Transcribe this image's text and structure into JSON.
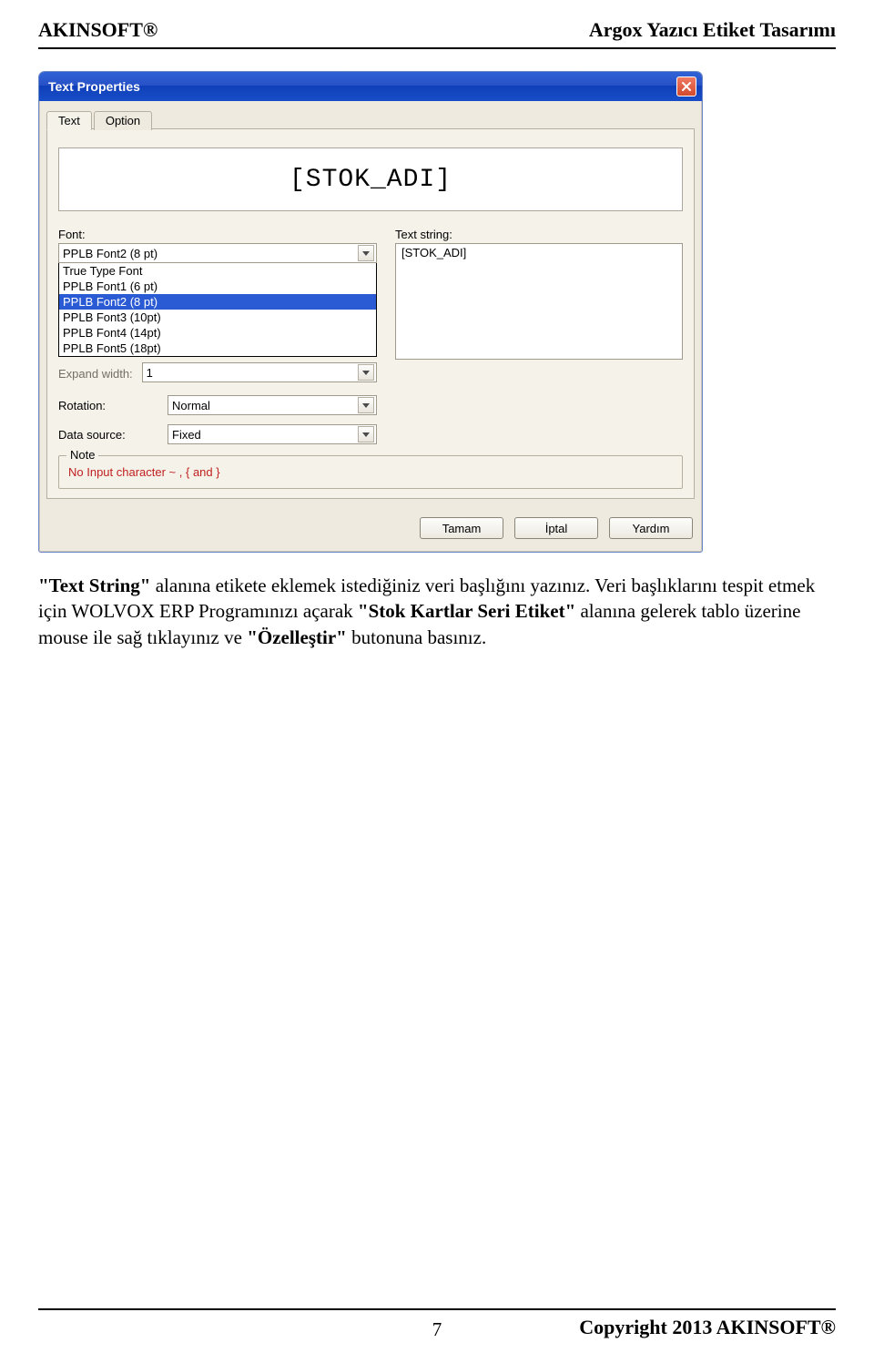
{
  "page": {
    "header_left": "AKINSOFT®",
    "header_right": "Argox Yazıcı Etiket Tasarımı",
    "footer_right": "Copyright 2013 AKINSOFT®",
    "page_number": "7"
  },
  "dialog": {
    "title": "Text Properties",
    "tabs": {
      "text": "Text",
      "option": "Option"
    },
    "preview": "[STOK_ADI]",
    "labels": {
      "font": "Font:",
      "text_string": "Text string:",
      "expand_width_partial": "Expand width:",
      "rotation": "Rotation:",
      "data_source": "Data source:",
      "note_legend": "Note",
      "note_text": "No Input character ~ , { and }"
    },
    "font_selected": "PPLB Font2 (8 pt)",
    "font_options": {
      "o0": "True Type Font",
      "o1": "PPLB Font1 (6 pt)",
      "o2": "PPLB Font2 (8 pt)",
      "o3": "PPLB Font3 (10pt)",
      "o4": "PPLB Font4 (14pt)",
      "o5": "PPLB Font5 (18pt)"
    },
    "expand_width_value": "1",
    "rotation_value": "Normal",
    "data_source_value": "Fixed",
    "text_string_value": "[STOK_ADI]",
    "buttons": {
      "ok": "Tamam",
      "cancel": "İptal",
      "help": "Yardım"
    }
  },
  "body": {
    "p1_prefix": "\"Text String\"",
    "p1_rest": " alanına etikete eklemek istediğiniz veri başlığını yazınız. Veri başlıklarını tespit etmek için WOLVOX ERP Programınızı açarak ",
    "p1_bold2": "\"Stok Kartlar Seri Etiket\"",
    "p1_after": " alanına gelerek tablo üzerine mouse ile sağ tıklayınız ve ",
    "p1_bold3": "\"Özelleştir\"",
    "p1_tail": " butonuna basınız."
  }
}
